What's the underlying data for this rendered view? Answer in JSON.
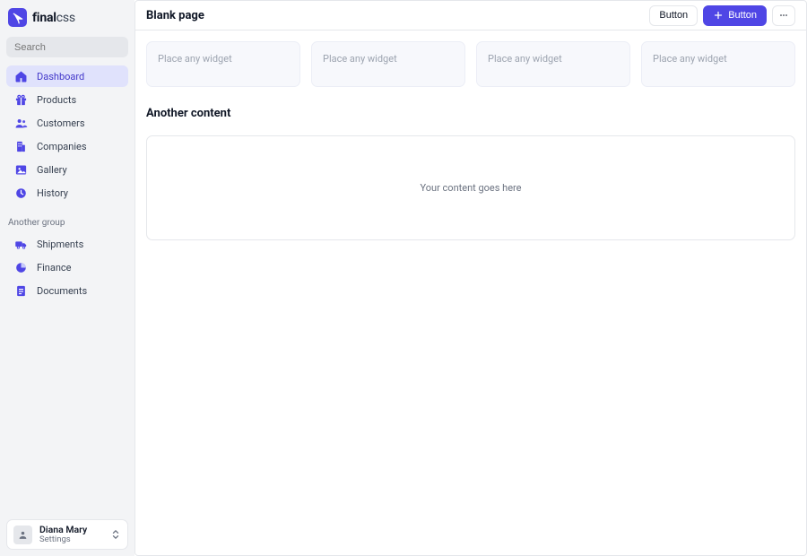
{
  "brand": {
    "strong": "final",
    "light": "css"
  },
  "search": {
    "placeholder": "Search"
  },
  "sidebar": {
    "items": [
      {
        "label": "Dashboard"
      },
      {
        "label": "Products"
      },
      {
        "label": "Customers"
      },
      {
        "label": "Companies"
      },
      {
        "label": "Gallery"
      },
      {
        "label": "History"
      }
    ],
    "group_label": "Another group",
    "group_items": [
      {
        "label": "Shipments"
      },
      {
        "label": "Finance"
      },
      {
        "label": "Documents"
      }
    ]
  },
  "user": {
    "name": "Diana Mary",
    "sub": "Settings"
  },
  "header": {
    "title": "Blank page",
    "secondary_button": "Button",
    "primary_button": "Button"
  },
  "widgets": [
    {
      "placeholder": "Place any widget"
    },
    {
      "placeholder": "Place any widget"
    },
    {
      "placeholder": "Place any widget"
    },
    {
      "placeholder": "Place any widget"
    }
  ],
  "section": {
    "title": "Another content",
    "body": "Your content goes here"
  },
  "colors": {
    "accent": "#4f46e5",
    "muted_bg": "#f3f4f6"
  }
}
